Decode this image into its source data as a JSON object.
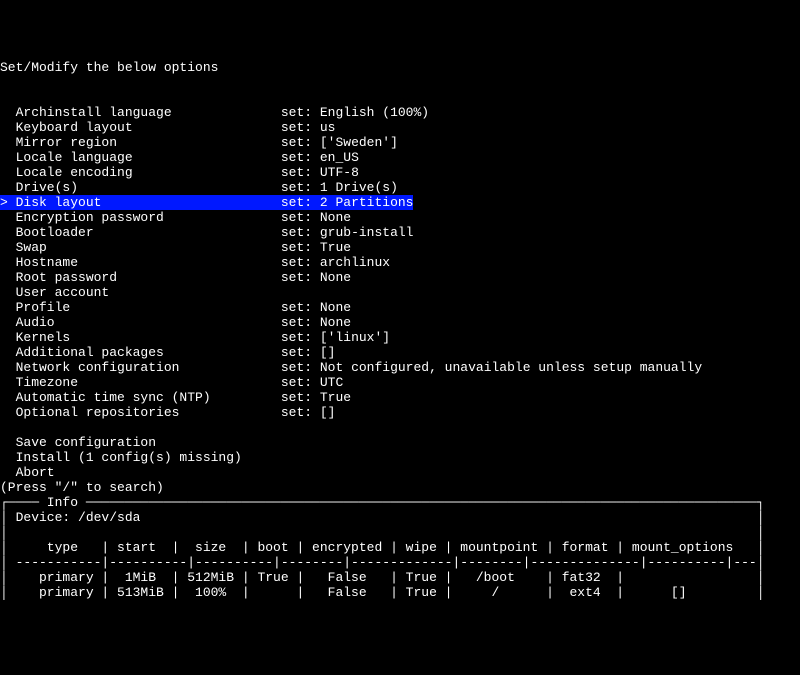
{
  "title": "Set/Modify the below options",
  "cursor": ">",
  "set_label": "set:",
  "options": [
    {
      "label": "Archinstall language",
      "value": "English (100%)",
      "selected": false
    },
    {
      "label": "Keyboard layout",
      "value": "us",
      "selected": false
    },
    {
      "label": "Mirror region",
      "value": "['Sweden']",
      "selected": false
    },
    {
      "label": "Locale language",
      "value": "en_US",
      "selected": false
    },
    {
      "label": "Locale encoding",
      "value": "UTF-8",
      "selected": false
    },
    {
      "label": "Drive(s)",
      "value": "1 Drive(s)",
      "selected": false
    },
    {
      "label": "Disk layout",
      "value": "2 Partitions",
      "selected": true
    },
    {
      "label": "Encryption password",
      "value": "None",
      "selected": false
    },
    {
      "label": "Bootloader",
      "value": "grub-install",
      "selected": false
    },
    {
      "label": "Swap",
      "value": "True",
      "selected": false
    },
    {
      "label": "Hostname",
      "value": "archlinux",
      "selected": false
    },
    {
      "label": "Root password",
      "value": "None",
      "selected": false
    },
    {
      "label": "User account",
      "value": "",
      "selected": false
    },
    {
      "label": "Profile",
      "value": "None",
      "selected": false
    },
    {
      "label": "Audio",
      "value": "None",
      "selected": false
    },
    {
      "label": "Kernels",
      "value": "['linux']",
      "selected": false
    },
    {
      "label": "Additional packages",
      "value": "[]",
      "selected": false
    },
    {
      "label": "Network configuration",
      "value": "Not configured, unavailable unless setup manually",
      "selected": false
    },
    {
      "label": "Timezone",
      "value": "UTC",
      "selected": false
    },
    {
      "label": "Automatic time sync (NTP)",
      "value": "True",
      "selected": false
    },
    {
      "label": "Optional repositories",
      "value": "[]",
      "selected": false
    }
  ],
  "actions": [
    "Save configuration",
    "Install (1 config(s) missing)",
    "Abort"
  ],
  "hint": "(Press \"/\" to search)",
  "info": {
    "title": " Info ",
    "device_label": "Device:",
    "device": "/dev/sda",
    "columns": [
      "type",
      "start",
      "size",
      "boot",
      "encrypted",
      "wipe",
      "mountpoint",
      "format",
      "mount_options"
    ],
    "rows": [
      {
        "type": "primary",
        "start": "1MiB",
        "size": "512MiB",
        "boot": "True",
        "encrypted": "False",
        "wipe": "True",
        "mountpoint": "/boot",
        "format": "fat32",
        "mount_options": ""
      },
      {
        "type": "primary",
        "start": "513MiB",
        "size": "100%",
        "boot": "",
        "encrypted": "False",
        "wipe": "True",
        "mountpoint": "/",
        "format": "ext4",
        "mount_options": "[]"
      }
    ]
  }
}
